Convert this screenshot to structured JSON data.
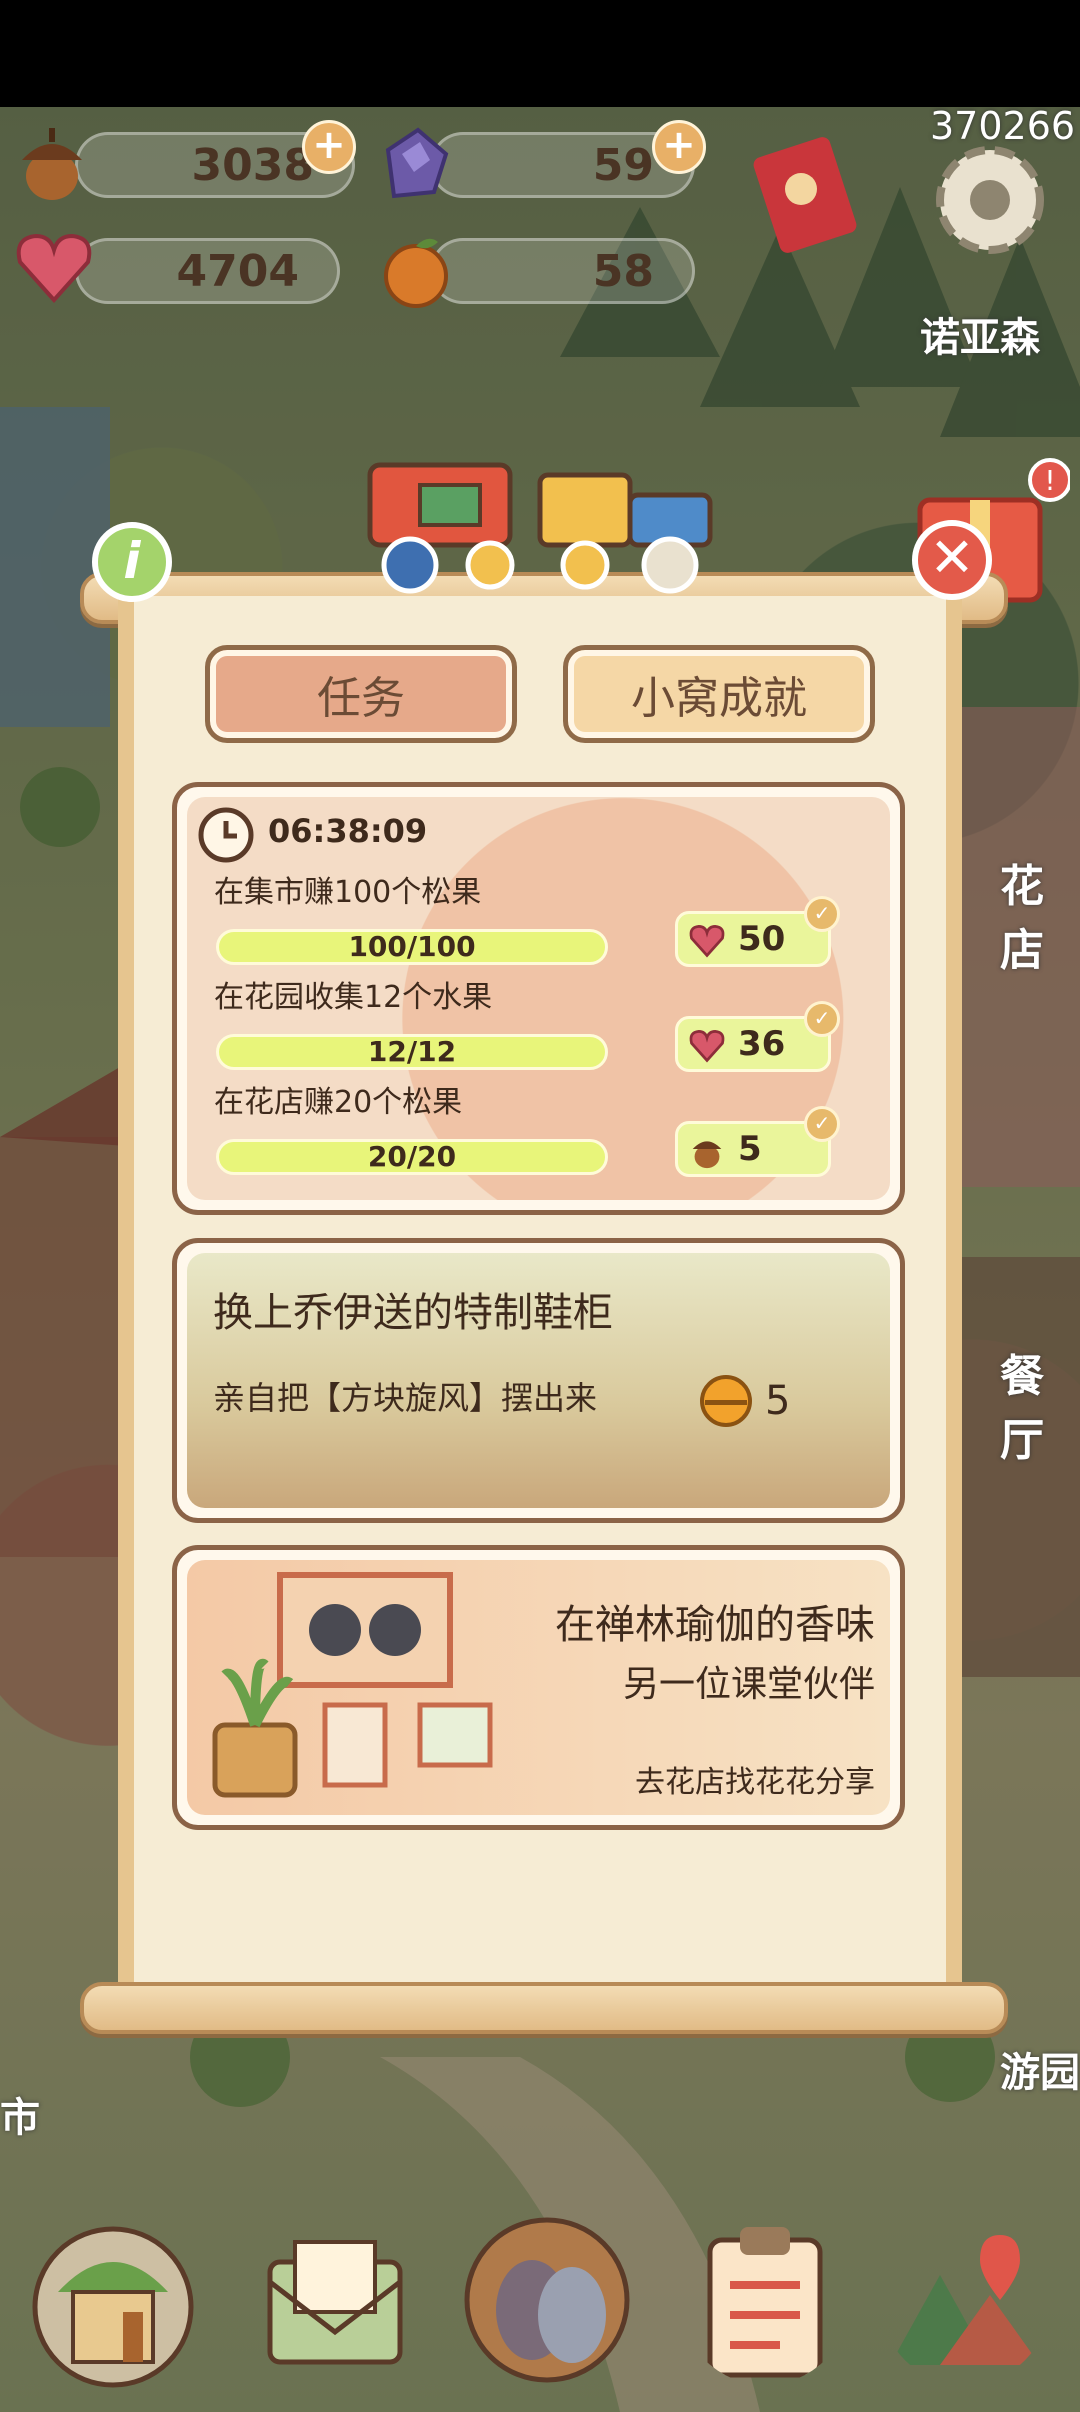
{
  "top_counter": "370266",
  "resources": {
    "acorn": "3038",
    "crystal": "59",
    "heart": "4704",
    "orange": "58",
    "plus": "+"
  },
  "side_labels": {
    "forest": "诺亚森",
    "flower_shop": "花店",
    "restaurant": "餐厅",
    "park": "游园",
    "market": "市"
  },
  "tabs": {
    "tasks": "任务",
    "achievements": "小窝成就"
  },
  "daily_card": {
    "timer": "06:38:09",
    "tasks": [
      {
        "label": "在集市赚100个松果",
        "progress_text": "100/100",
        "progress": 1.0,
        "reward_icon": "heart-gem-icon",
        "reward": "50"
      },
      {
        "label": "在花园收集12个水果",
        "progress_text": "12/12",
        "progress": 1.0,
        "reward_icon": "heart-gem-icon",
        "reward": "36"
      },
      {
        "label": "在花店赚20个松果",
        "progress_text": "20/20",
        "progress": 1.0,
        "reward_icon": "acorn-icon",
        "reward": "5"
      }
    ]
  },
  "story_card": {
    "title": "换上乔伊送的特制鞋柜",
    "desc": "亲自把【方块旋风】摆出来",
    "reward": "5"
  },
  "yoga_card": {
    "title": "在禅林瑜伽的香味",
    "subtitle": "另一位课堂伙伴",
    "hint": "去花店找花花分享"
  },
  "colors": {
    "tab_active": "#e6a98a",
    "tab_inactive": "#f5d7a6",
    "bar_fill": "#e8f57a",
    "card_border": "#8b6347"
  },
  "nav": [
    "home-icon",
    "mail-icon",
    "birds-icon",
    "checklist-icon",
    "map-icon"
  ]
}
